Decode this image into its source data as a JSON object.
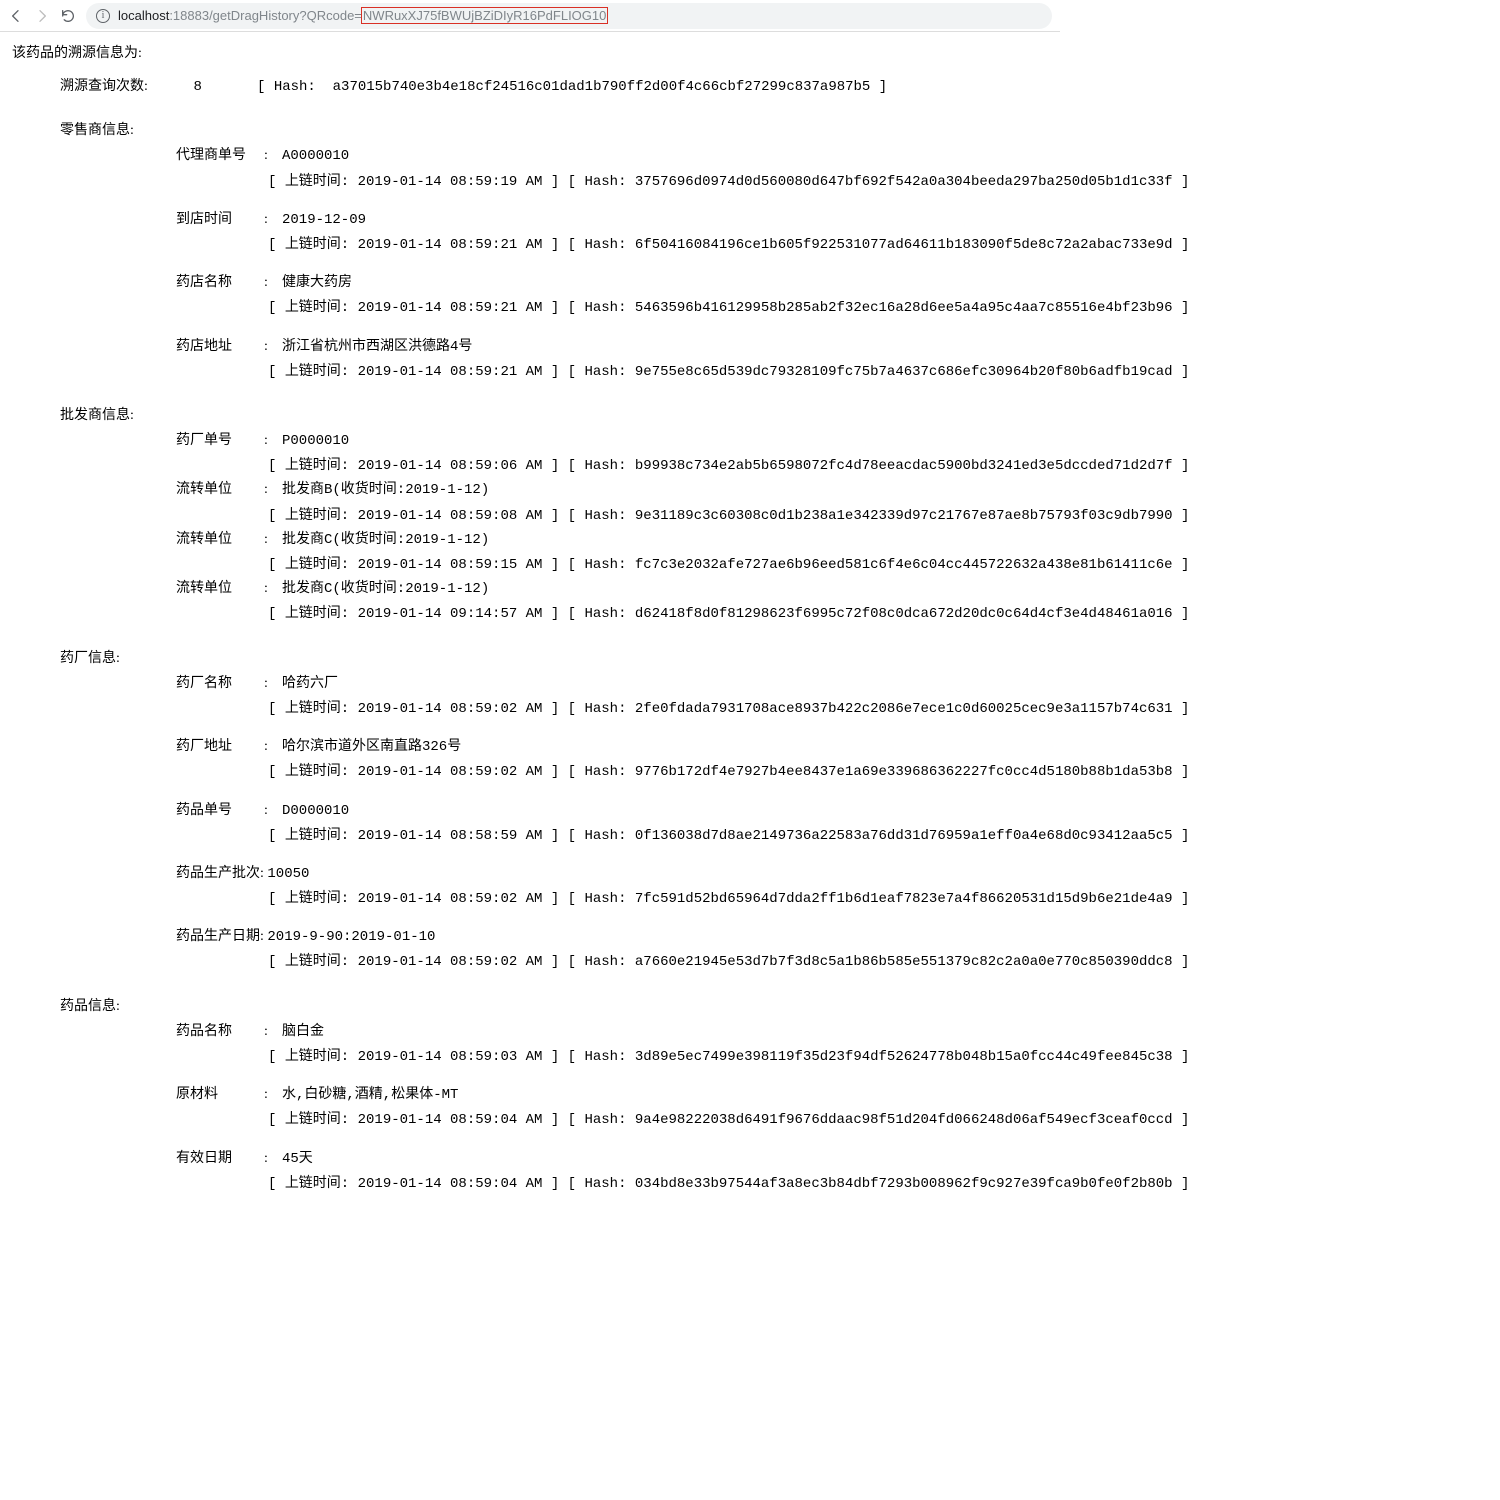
{
  "browser": {
    "url_host": "localhost",
    "url_port_path": ":18883/getDragHistory?QRcode=",
    "url_param": "NWRuxXJ75fBWUjBZiDIyR16PdFLIOG10"
  },
  "page": {
    "title": "该药品的溯源信息为:",
    "query": {
      "label": "溯源查询次数:",
      "value": "8",
      "hash": "a37015b740e3b4e18cf24516c01dad1b790ff2d00f4c66cbf27299c837a987b5"
    },
    "sections": {
      "retailer": {
        "title": "零售商信息:",
        "items": [
          {
            "label": "代理商单号",
            "value": "A0000010",
            "time": "2019-01-14 08:59:19 AM",
            "hash": "3757696d0974d0d560080d647bf692f542a0a304beeda297ba250d05b1d1c33f"
          },
          {
            "label": "到店时间",
            "value": "2019-12-09",
            "time": "2019-01-14 08:59:21 AM",
            "hash": "6f50416084196ce1b605f922531077ad64611b183090f5de8c72a2abac733e9d"
          },
          {
            "label": "药店名称",
            "value": "健康大药房",
            "time": "2019-01-14 08:59:21 AM",
            "hash": "5463596b416129958b285ab2f32ec16a28d6ee5a4a95c4aa7c85516e4bf23b96"
          },
          {
            "label": "药店地址",
            "value": "浙江省杭州市西湖区洪德路4号",
            "time": "2019-01-14 08:59:21 AM",
            "hash": "9e755e8c65d539dc79328109fc75b7a4637c686efc30964b20f80b6adfb19cad"
          }
        ]
      },
      "wholesaler": {
        "title": "批发商信息:",
        "items": [
          {
            "label": "药厂单号",
            "value": "P0000010",
            "time": "2019-01-14 08:59:06 AM",
            "hash": "b99938c734e2ab5b6598072fc4d78eeacdac5900bd3241ed3e5dccded71d2d7f"
          },
          {
            "label": "流转单位",
            "value": "批发商B(收货时间:2019-1-12)",
            "time": "2019-01-14 08:59:08 AM",
            "hash": "9e31189c3c60308c0d1b238a1e342339d97c21767e87ae8b75793f03c9db7990"
          },
          {
            "label": "流转单位",
            "value": "批发商C(收货时间:2019-1-12)",
            "time": "2019-01-14 08:59:15 AM",
            "hash": "fc7c3e2032afe727ae6b96eed581c6f4e6c04cc445722632a438e81b61411c6e"
          },
          {
            "label": "流转单位",
            "value": "批发商C(收货时间:2019-1-12)",
            "time": "2019-01-14 09:14:57 AM",
            "hash": "d62418f8d0f81298623f6995c72f08c0dca672d20dc0c64d4cf3e4d48461a016"
          }
        ]
      },
      "factory": {
        "title": "药厂信息:",
        "items": [
          {
            "label": "药厂名称",
            "value": "哈药六厂",
            "time": "2019-01-14 08:59:02 AM",
            "hash": "2fe0fdada7931708ace8937b422c2086e7ece1c0d60025cec9e3a1157b74c631"
          },
          {
            "label": "药厂地址",
            "value": "哈尔滨市道外区南直路326号",
            "time": "2019-01-14 08:59:02 AM",
            "hash": "9776b172df4e7927b4ee8437e1a69e339686362227fc0cc4d5180b88b1da53b8"
          },
          {
            "label": "药品单号",
            "value": "D0000010",
            "time": "2019-01-14 08:58:59 AM",
            "hash": "0f136038d7d8ae2149736a22583a76dd31d76959a1eff0a4e68d0c93412aa5c5"
          },
          {
            "label": "药品生产批次",
            "value": "10050",
            "time": "2019-01-14 08:59:02 AM",
            "hash": "7fc591d52bd65964d7dda2ff1b6d1eaf7823e7a4f86620531d15d9b6e21de4a9",
            "nolabel_width": true
          },
          {
            "label": "药品生产日期",
            "value": "2019-9-90:2019-01-10",
            "time": "2019-01-14 08:59:02 AM",
            "hash": "a7660e21945e53d7b7f3d8c5a1b86b585e551379c82c2a0a0e770c850390ddc8",
            "nolabel_width": true
          }
        ]
      },
      "drug": {
        "title": "药品信息:",
        "items": [
          {
            "label": "药品名称",
            "value": "脑白金",
            "time": "2019-01-14 08:59:03 AM",
            "hash": "3d89e5ec7499e398119f35d23f94df52624778b048b15a0fcc44c49fee845c38"
          },
          {
            "label": "原材料",
            "value": "水,白砂糖,酒精,松果体-MT",
            "time": "2019-01-14 08:59:04 AM",
            "hash": "9a4e98222038d6491f9676ddaac98f51d204fd066248d06af549ecf3ceaf0ccd"
          },
          {
            "label": "有效日期",
            "value": "45天",
            "time": "2019-01-14 08:59:04 AM",
            "hash": "034bd8e33b97544af3a8ec3b84dbf7293b008962f9c927e39fca9b0fe0f2b80b"
          }
        ]
      }
    },
    "txt": {
      "chain_time": "上链时间:",
      "hash": "Hash:"
    }
  }
}
